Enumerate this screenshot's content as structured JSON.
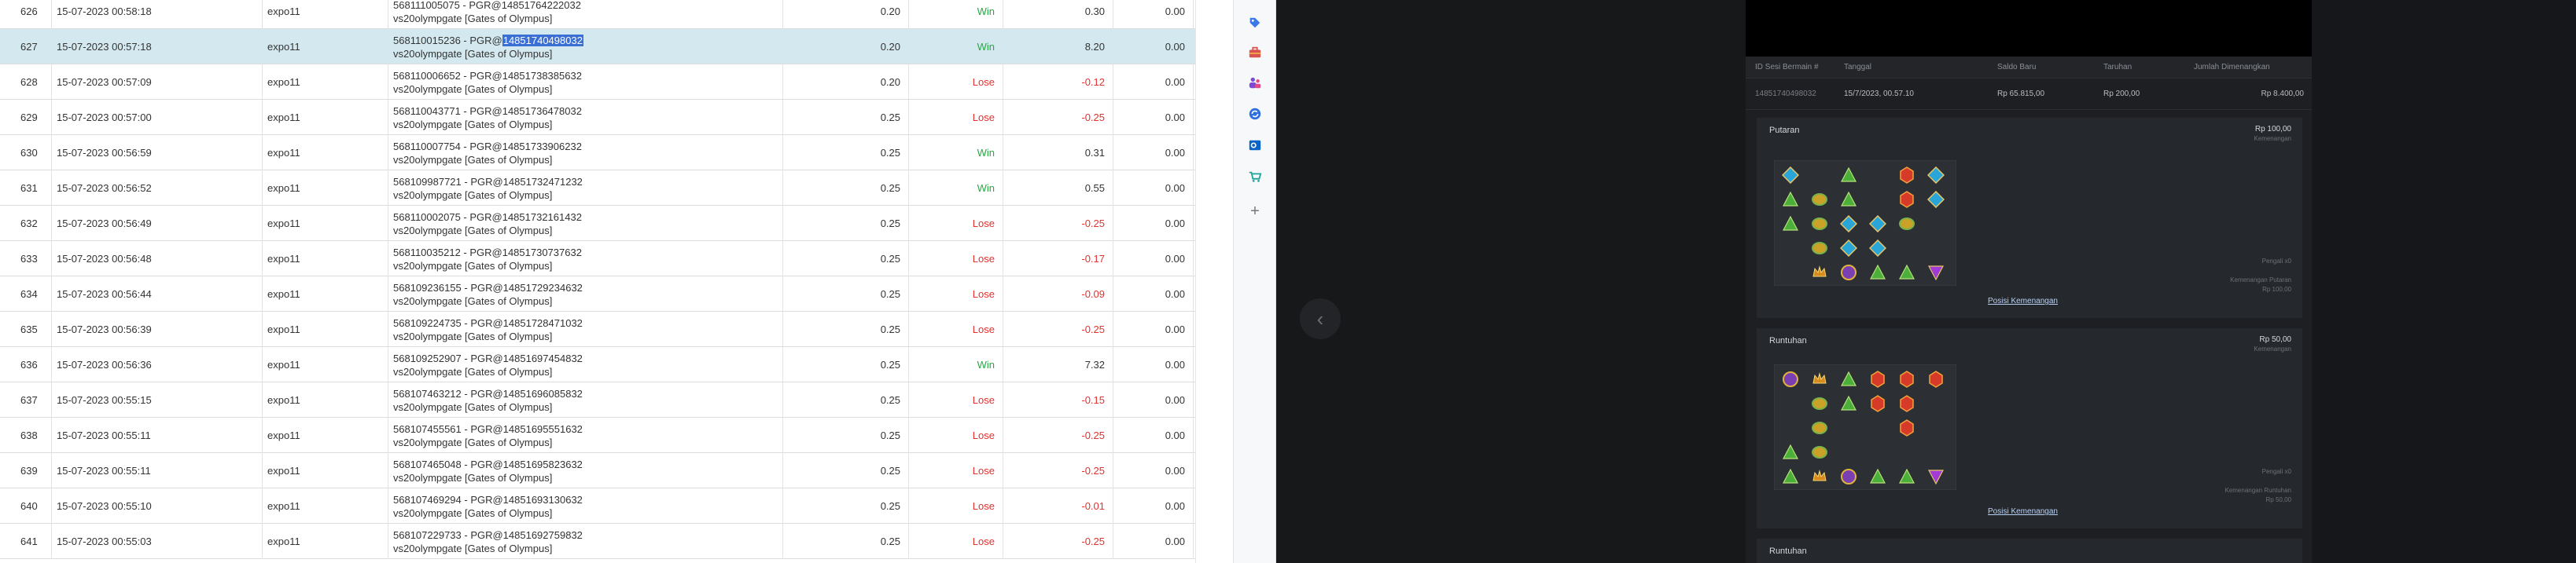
{
  "transactions": [
    {
      "no": "626",
      "date": "15-07-2023 00:58:18",
      "user": "expo11",
      "desc_id": "568111005075 - PGR@14851764222032",
      "desc_hl": "",
      "desc_game": "vs20olympgate [Gates of Olympus]",
      "bet": "0.20",
      "result": "Win",
      "win": "0.30",
      "balance": "0.00"
    },
    {
      "no": "627",
      "date": "15-07-2023 00:57:18",
      "user": "expo11",
      "desc_id": "568110015236 - PGR@",
      "desc_hl": "14851740498032",
      "desc_game": "vs20olympgate [Gates of Olympus]",
      "bet": "0.20",
      "result": "Win",
      "win": "8.20",
      "balance": "0.00"
    },
    {
      "no": "628",
      "date": "15-07-2023 00:57:09",
      "user": "expo11",
      "desc_id": "568110006652 - PGR@14851738385632",
      "desc_hl": "",
      "desc_game": "vs20olympgate [Gates of Olympus]",
      "bet": "0.20",
      "result": "Lose",
      "win": "-0.12",
      "balance": "0.00"
    },
    {
      "no": "629",
      "date": "15-07-2023 00:57:00",
      "user": "expo11",
      "desc_id": "568110043771 - PGR@14851736478032",
      "desc_hl": "",
      "desc_game": "vs20olympgate [Gates of Olympus]",
      "bet": "0.25",
      "result": "Lose",
      "win": "-0.25",
      "balance": "0.00"
    },
    {
      "no": "630",
      "date": "15-07-2023 00:56:59",
      "user": "expo11",
      "desc_id": "568110007754 - PGR@14851733906232",
      "desc_hl": "",
      "desc_game": "vs20olympgate [Gates of Olympus]",
      "bet": "0.25",
      "result": "Win",
      "win": "0.31",
      "balance": "0.00"
    },
    {
      "no": "631",
      "date": "15-07-2023 00:56:52",
      "user": "expo11",
      "desc_id": "568109987721 - PGR@14851732471232",
      "desc_hl": "",
      "desc_game": "vs20olympgate [Gates of Olympus]",
      "bet": "0.25",
      "result": "Win",
      "win": "0.55",
      "balance": "0.00"
    },
    {
      "no": "632",
      "date": "15-07-2023 00:56:49",
      "user": "expo11",
      "desc_id": "568110002075 - PGR@14851732161432",
      "desc_hl": "",
      "desc_game": "vs20olympgate [Gates of Olympus]",
      "bet": "0.25",
      "result": "Lose",
      "win": "-0.25",
      "balance": "0.00"
    },
    {
      "no": "633",
      "date": "15-07-2023 00:56:48",
      "user": "expo11",
      "desc_id": "568110035212 - PGR@14851730737632",
      "desc_hl": "",
      "desc_game": "vs20olympgate [Gates of Olympus]",
      "bet": "0.25",
      "result": "Lose",
      "win": "-0.17",
      "balance": "0.00"
    },
    {
      "no": "634",
      "date": "15-07-2023 00:56:44",
      "user": "expo11",
      "desc_id": "568109236155 - PGR@14851729234632",
      "desc_hl": "",
      "desc_game": "vs20olympgate [Gates of Olympus]",
      "bet": "0.25",
      "result": "Lose",
      "win": "-0.09",
      "balance": "0.00"
    },
    {
      "no": "635",
      "date": "15-07-2023 00:56:39",
      "user": "expo11",
      "desc_id": "568109224735 - PGR@14851728471032",
      "desc_hl": "",
      "desc_game": "vs20olympgate [Gates of Olympus]",
      "bet": "0.25",
      "result": "Lose",
      "win": "-0.25",
      "balance": "0.00"
    },
    {
      "no": "636",
      "date": "15-07-2023 00:56:36",
      "user": "expo11",
      "desc_id": "568109252907 - PGR@14851697454832",
      "desc_hl": "",
      "desc_game": "vs20olympgate [Gates of Olympus]",
      "bet": "0.25",
      "result": "Win",
      "win": "7.32",
      "balance": "0.00"
    },
    {
      "no": "637",
      "date": "15-07-2023 00:55:15",
      "user": "expo11",
      "desc_id": "568107463212 - PGR@14851696085832",
      "desc_hl": "",
      "desc_game": "vs20olympgate [Gates of Olympus]",
      "bet": "0.25",
      "result": "Lose",
      "win": "-0.15",
      "balance": "0.00"
    },
    {
      "no": "638",
      "date": "15-07-2023 00:55:11",
      "user": "expo11",
      "desc_id": "568107455561 - PGR@14851695551632",
      "desc_hl": "",
      "desc_game": "vs20olympgate [Gates of Olympus]",
      "bet": "0.25",
      "result": "Lose",
      "win": "-0.25",
      "balance": "0.00"
    },
    {
      "no": "639",
      "date": "15-07-2023 00:55:11",
      "user": "expo11",
      "desc_id": "568107465048 - PGR@14851695823632",
      "desc_hl": "",
      "desc_game": "vs20olympgate [Gates of Olympus]",
      "bet": "0.25",
      "result": "Lose",
      "win": "-0.25",
      "balance": "0.00"
    },
    {
      "no": "640",
      "date": "15-07-2023 00:55:10",
      "user": "expo11",
      "desc_id": "568107469294 - PGR@14851693130632",
      "desc_hl": "",
      "desc_game": "vs20olympgate [Gates of Olympus]",
      "bet": "0.25",
      "result": "Lose",
      "win": "-0.01",
      "balance": "0.00"
    },
    {
      "no": "641",
      "date": "15-07-2023 00:55:03",
      "user": "expo11",
      "desc_id": "568107229733 - PGR@14851692759832",
      "desc_hl": "",
      "desc_game": "vs20olympgate [Gates of Olympus]",
      "bet": "0.25",
      "result": "Lose",
      "win": "-0.25",
      "balance": "0.00"
    }
  ],
  "side_rail": {
    "icons": [
      "tag-icon",
      "toolbox-icon",
      "people-icon",
      "sync-icon",
      "outlook-icon",
      "cart-icon",
      "plus-icon"
    ]
  },
  "history_panel": {
    "headers": {
      "round_id": "ID Sesi Bermain #",
      "date": "Tanggal",
      "balance": "Saldo Baru",
      "bet": "Taruhan",
      "total_win": "Jumlah Dimenangkan"
    },
    "info": {
      "round_id": "14851740498032",
      "date": "15/7/2023, 00.57.10",
      "balance": "Rp 65.815,00",
      "bet": "Rp 200,00",
      "total_win": "Rp 8.400,00"
    },
    "sections": [
      {
        "title": "Putaran",
        "amount": "Rp 100,00",
        "amount_sub": "Kemenangan",
        "pengali": "Pengali x0",
        "win_label": "Kemenangan Putaran",
        "win_value": "Rp 100,00",
        "link": "Posisi Kemenangan"
      },
      {
        "title": "Runtuhan",
        "amount": "Rp 50,00",
        "amount_sub": "Kemenangan",
        "pengali": "Pengali x0",
        "win_label": "Kemenangan Runtuhan",
        "win_value": "Rp 50,00",
        "link": "Posisi Kemenangan"
      },
      {
        "title": "Runtuhan"
      }
    ]
  },
  "colors": {
    "win": "#28a745",
    "lose": "#e0322f",
    "selected_row": "#d4e9ef",
    "highlight": "#3a70d6"
  }
}
